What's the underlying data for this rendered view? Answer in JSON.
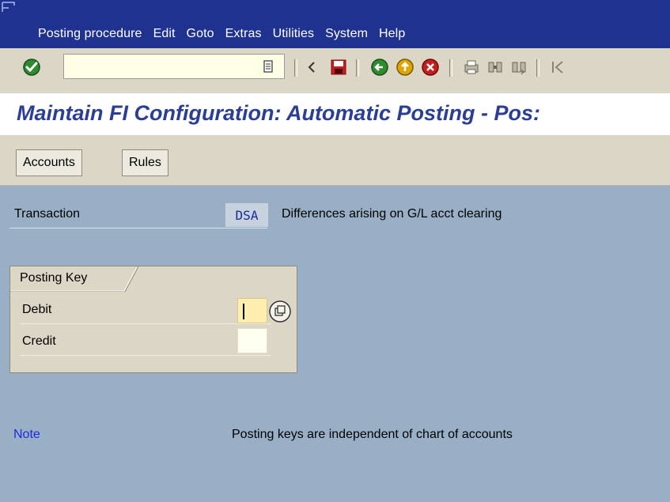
{
  "menubar": {
    "items": [
      "Posting procedure",
      "Edit",
      "Goto",
      "Extras",
      "Utilities",
      "System",
      "Help"
    ]
  },
  "toolbar": {
    "command_field_value": "",
    "icons": [
      "enter-icon",
      "dropdown-icon",
      "back-arrow-icon",
      "save-icon",
      "back-icon",
      "exit-icon",
      "cancel-icon",
      "print-icon",
      "find-icon",
      "find-next-icon",
      "first-page-icon"
    ]
  },
  "title": "Maintain FI Configuration: Automatic Posting - Pos:",
  "app_toolbar": {
    "accounts_label": "Accounts",
    "rules_label": "Rules"
  },
  "transaction": {
    "label": "Transaction",
    "code": "DSA",
    "description": "Differences arising on G/L acct clearing"
  },
  "posting_key": {
    "title": "Posting Key",
    "debit_label": "Debit",
    "debit_value": "",
    "credit_label": "Credit",
    "credit_value": ""
  },
  "note": {
    "label": "Note",
    "text": "Posting keys are independent of chart of accounts"
  },
  "colors": {
    "menubar": "#1f3290",
    "title": "#2b3e96",
    "background": "#98afc6",
    "toolbar": "#dcd6c6",
    "note_label": "#1a2bdc"
  }
}
